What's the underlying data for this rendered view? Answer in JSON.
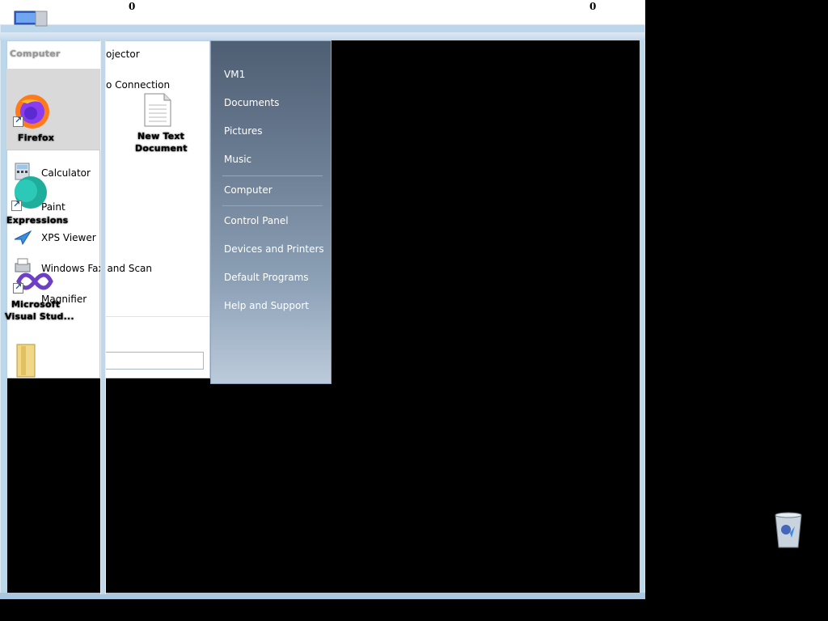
{
  "top_bar": {
    "counter_left": "0",
    "counter_right": "0"
  },
  "start_menu": {
    "left_items": [
      {
        "label": "ojector",
        "icon": "projector-icon"
      },
      {
        "label": "o Connection",
        "icon": "remote-desktop-icon"
      },
      {
        "label": "Calculator",
        "icon": "calculator-icon"
      },
      {
        "label": "Paint",
        "icon": "paint-icon"
      },
      {
        "label": "XPS Viewer",
        "icon": "xps-viewer-icon"
      },
      {
        "label": "Windows Fax and Scan",
        "icon": "fax-scan-icon"
      },
      {
        "label": "Magnifier",
        "icon": "magnifier-icon"
      }
    ],
    "right_items": {
      "user": "VM1",
      "documents": "Documents",
      "pictures": "Pictures",
      "music": "Music",
      "computer": "Computer",
      "control_panel": "Control Panel",
      "devices_printers": "Devices and Printers",
      "default_programs": "Default Programs",
      "help_support": "Help and Support"
    }
  },
  "desktop": {
    "firefox_label": "Firefox",
    "computer_label": "Computer",
    "expressions_label": "Expressions",
    "vs_label_line1": "Microsoft",
    "vs_label_line2": "Visual Stud...",
    "new_doc_line1": "New Text",
    "new_doc_line2": "Document"
  },
  "colors": {
    "accent": "#4e5e73",
    "glass": "#bcd6ea"
  }
}
